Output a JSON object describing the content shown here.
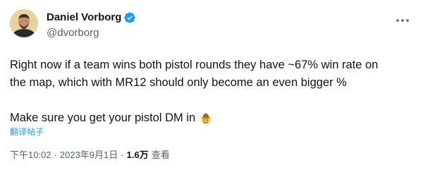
{
  "author": {
    "display_name": "Daniel Vorborg",
    "handle": "@dvorborg"
  },
  "tweet": {
    "line1": "Right now if a team wins both pistol rounds they have ~67% win rate on",
    "line2": "the map, which with MR12 should only become an even bigger %",
    "line3": "Make sure you get your pistol DM in",
    "emoji": "cowboy-hat-face-icon"
  },
  "translate_label": "翻译帖子",
  "meta": {
    "time": "下午10:02",
    "date": "2023年9月1日",
    "views_count": "1.6万",
    "views_label": "查看"
  },
  "colors": {
    "text_primary": "#0f1419",
    "text_secondary": "#536471",
    "accent": "#1d9bf0",
    "verified": "#1d9bf0"
  }
}
